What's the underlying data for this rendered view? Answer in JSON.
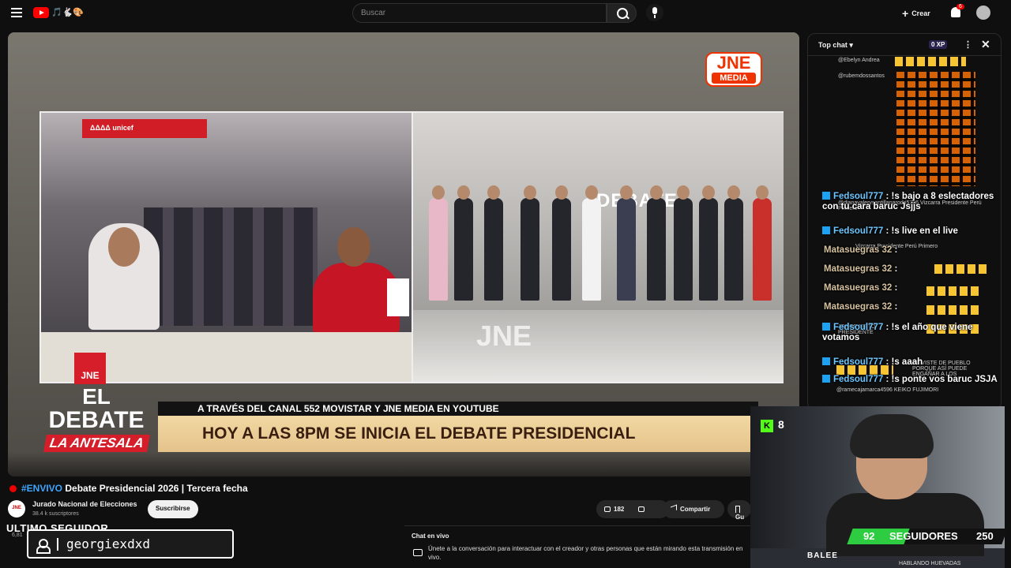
{
  "topbar": {
    "brand_text": "🎵🐇🎨",
    "search_placeholder": "Buscar",
    "create_label": "Crear",
    "notifications_count": "6"
  },
  "player": {
    "unicef_banner": "ΔΔΔΔ unicef",
    "debate_sign": "DEBATE",
    "floor_logo": "JNE",
    "jne_media": {
      "top": "JNE",
      "bottom": "MEDIA"
    },
    "overlay": {
      "logo_text": "JNE",
      "el": "EL",
      "debate": "DEBATE",
      "antesala": "LA ANTESALA",
      "subline": "A TRAVÉS DEL CANAL 552 MOVISTAR  Y  JNE MEDIA EN YOUTUBE",
      "ticker": "HOY A LAS 8PM SE INICIA EL DEBATE PRESIDENCIAL"
    }
  },
  "video": {
    "hashtag": "#ENVIVO",
    "title": " Debate Presidencial 2026 | Tercera fecha",
    "channel_logo": "JNE",
    "channel_name": "Jurado Nacional de Elecciones",
    "subscribers": "38.4 k suscriptores",
    "subscribe_label": "Suscribirse",
    "likes": "182",
    "share_label": "Compartir",
    "save_label": "Gu"
  },
  "overlay_follower": {
    "heading": "ULTIMO SEGUIDOR",
    "name": "georgiexdxd",
    "small": "6,81"
  },
  "live_chat_strip": {
    "title": "Chat en vivo",
    "text": "Únete a la conversación para interactuar con el creador y otras personas que están mirando esta transmisión en vivo."
  },
  "chat": {
    "mode": "Top chat",
    "xp": "0 XP",
    "rows": [
      {
        "text": "@Ebelyn Andrea"
      },
      {
        "text": "@rubemdossantos"
      },
      {
        "text": "@dianavalerysantillanarodri5706  Vizcarra Presidente  Perú Primero"
      },
      {
        "text": "Vizcarra Presidente  Perú Primero"
      },
      {
        "text": "JORGE NIETO PRESIDENTE"
      },
      {
        "text": "@ramecajamarca4596  KEIKO FUJIMORI"
      }
    ],
    "messages": [
      {
        "user": "Fedsoul777",
        "text": ": !s bajo a 8 eslectadores con tu cara baruc Jsjjs"
      },
      {
        "user": "Fedsoul777",
        "text": ": !s live en el live"
      },
      {
        "user": "Matasuegras 32",
        "text": ":"
      },
      {
        "user": "Matasuegras 32",
        "text": ":"
      },
      {
        "user": "Matasuegras 32",
        "text": ":"
      },
      {
        "user": "Matasuegras 32",
        "text": ":"
      },
      {
        "user": "Fedsoul777",
        "text": ": !s el año que viene votamos"
      },
      {
        "user": "Fedsoul777",
        "text": ": !s aaah"
      },
      {
        "user": "Fedsoul777",
        "text": ": !s ponte vos baruc JSJA"
      }
    ],
    "extra_text": "SE VISTE DE PUEBLO PORQUE ASÍ PUEDE ENGAÑAR A LOS"
  },
  "webcam": {
    "kick_count": "8",
    "followers_current": "92",
    "followers_label": "SEGUIDORES",
    "followers_goal": "250",
    "followers_progress": 0.368,
    "streamer_name": "BALEE",
    "bottom_note": "HABLANDO HUEVADAS"
  },
  "colors": {
    "accent_red": "#d61d2a",
    "progress_green": "#2ecc40",
    "kick_green": "#53fc18",
    "ticker_gold": "#e4c38a"
  }
}
